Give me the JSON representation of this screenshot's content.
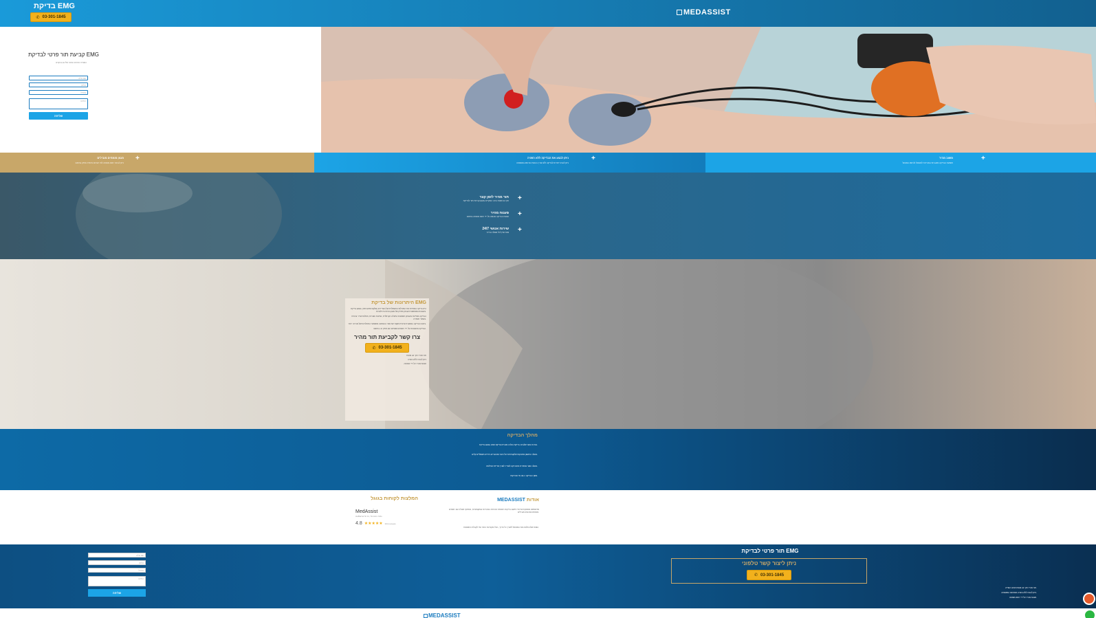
{
  "header": {
    "title": "בדיקת EMG",
    "phone": "03-301-1845",
    "logo": "MEDASSIST"
  },
  "hero_form": {
    "title": "קביעת תור פרטי לבדיקת EMG",
    "subtitle": "השאירו פרטים ונחזור אליכם בהקדם",
    "name_placeholder": "שם מלא",
    "phone_placeholder": "טלפון",
    "email_placeholder": "אימייל",
    "message_placeholder": "הודעה",
    "submit": "שליחה"
  },
  "strip": [
    {
      "title": "מגוון מומחים מובילים",
      "desc": "ניתן לבחור רופא מומחה לפי העדפה אישית וניסיון בתחום"
    },
    {
      "title": "ניתן לבצע את הבדיקה ללא הפניה",
      "desc": "ניתן להגיע ישירות לבדיקה ללא צורך בהפניה מרופא המשפחה"
    },
    {
      "title": "משוב מהיר",
      "desc": "תוצאות הבדיקה מועברות במהירות למטופל ולרופא המטפל"
    }
  ],
  "band2": [
    {
      "title": "תור מהיר לזמן קצר",
      "desc": "קביעת תור לבדיקת EMG תוך 24 שעות ברוב המקרים"
    },
    {
      "title": "פענוח מהיר",
      "desc": "פענוח הבדיקה מבוצע על ידי רופא מומחה בתחום"
    },
    {
      "title": "שירות אנושי 24/7",
      "desc": "צוות זמין לכל שאלה ובירור"
    }
  ],
  "advantages": {
    "title": "היתרונות של בדיקת EMG",
    "p1": "בדיקת EMG (אלקטרומיוגרפיה) היא בדיקה המודדת את הפעילות החשמלית של השרירים והעצבים ומאפשרת אבחון מדויק של מגוון בעיות נוירולוגיות.",
    "p2": "הבדיקה מסייעת באבחון תסמונת התעלה הקרפלית, פגיעות עצביות, מחלות שריר ובעיות בעמוד השדרה.",
    "p3": "ביצוע הבדיקה במסגרת פרטית מקצר את זמני ההמתנה ומאפשר התחלת טיפול מהירה יותר.",
    "p4": "הבדיקה מתבצעת על ידי רופאים מומחים עם ניסיון רב בתחום.",
    "cta": "צרו קשר לקביעת תור מהיר",
    "phone": "03-301-1845",
    "items": [
      "תור מהיר תוך 24 שעות",
      "ניתן להגיע ללא הפניה",
      "פענוח מהיר על ידי מומחה"
    ]
  },
  "process": {
    "title": "מהלך הבדיקה",
    "p1": "בדיקת EMG נערכת בשני שלבים: בדיקת הולכה עצבית ובדיקת מחט.",
    "p2": "בשלב הראשון מודבקות אלקטרודות על העור ומועברים גירויים חשמליים קלים.",
    "p3": "בשלב השני מוחדרת מחט דקה לשריר לצורך מדידת פעילותו.",
    "p4": "משך הבדיקה כ-30 עד 60 דקות."
  },
  "about": {
    "title_prefix": "אודות",
    "title_brand": "MEDASSIST",
    "p1": "מדאסיסט מספקת שירותי תיאום בדיקות רפואיות פרטיות במהירות ובמקצועיות, בשיתוף פעולה עם רופאים מומחים ומכונים מובילים.",
    "p2": "הצוות שלנו מלווה את המטופל לאורך כל הדרך, החל מקביעת התור ועד לקבלת התוצאות."
  },
  "reviews": {
    "title": "המלצות לקוחות בגוגל",
    "name": "MedAssist",
    "address": "HaBarzel St 11, Tel Aviv-Yafo",
    "rating": "4.8",
    "stars": "★★★★★",
    "count": "334 reviews"
  },
  "footer": {
    "title": "תור פרטי לבדיקת EMG",
    "box_title": "ניתן ליצור קשר טלפוני",
    "phone": "03-301-1845",
    "name_placeholder": "שם מלא",
    "phone_placeholder": "טלפון",
    "email_placeholder": "אימייל",
    "message_placeholder": "הודעה",
    "submit": "שליחה",
    "items": [
      "תור מהיר תוך 24 שעות מרגע הפנייה.",
      "ניתן להגיע ללא הפניה ממרופא המשפחה.",
      "פענוח מהיר על ידי רופא מומחה."
    ],
    "logo": "MEDASSIST"
  }
}
